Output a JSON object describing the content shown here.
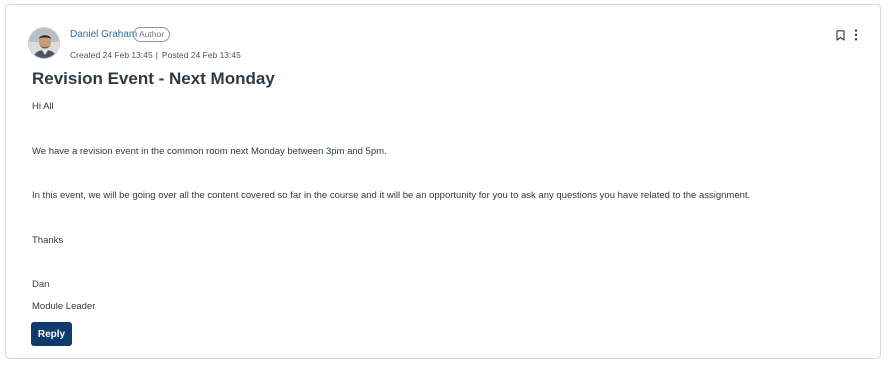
{
  "post": {
    "author_name": "Daniel Graham",
    "author_badge": "Author",
    "created": "Created 24 Feb 13:45",
    "posted": "Posted 24 Feb 13:45",
    "separator": "|",
    "title": "Revision Event - Next Monday",
    "body": {
      "greeting": "Hi All",
      "p1": "We have a revision event in the common room next Monday between 3pm and 5pm.",
      "p2": "In this event, we will be going over all the content covered so far in the course and it will be an opportunity for you to ask any questions you have related to the assignment.",
      "thanks": "Thanks",
      "signature_name": "Dan",
      "signature_role": "Module Leader"
    },
    "reply_label": "Reply"
  },
  "icons": {
    "bookmark": "bookmark-icon",
    "more": "more-options-icon"
  },
  "colors": {
    "link": "#2b6ba8",
    "reply_button": "#0c3b6c",
    "text": "#2d3b45"
  }
}
